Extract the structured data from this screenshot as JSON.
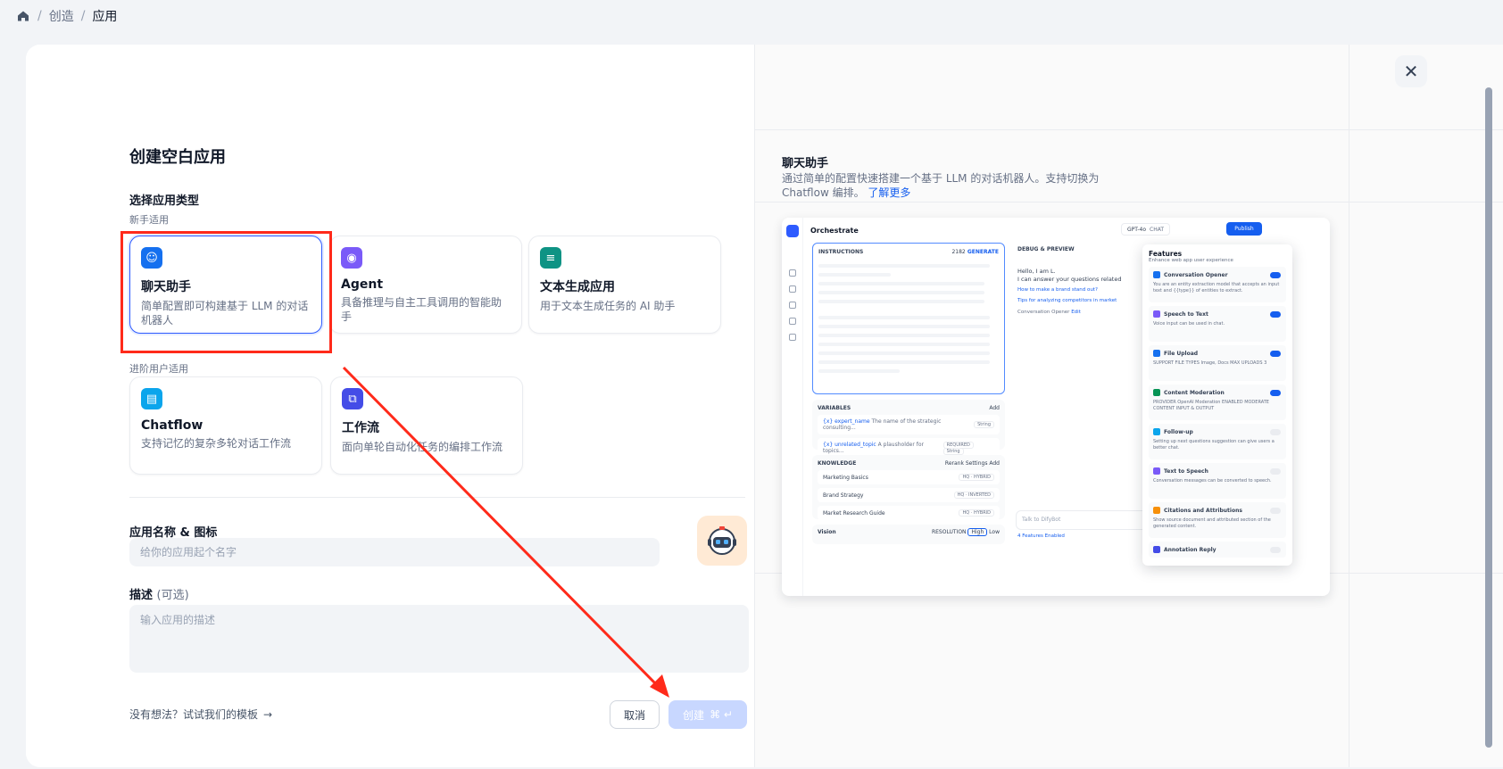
{
  "breadcrumb": {
    "items": [
      "创造",
      "应用"
    ],
    "sep": "/"
  },
  "modal": {
    "title": "创建空白应用",
    "type_section": "选择应用类型",
    "beginner_label": "新手适用",
    "advanced_label": "进阶用户适用",
    "types": [
      {
        "name": "聊天助手",
        "desc": "简单配置即可构建基于 LLM 的对话机器人",
        "color": "#1570ef",
        "selected": true
      },
      {
        "name": "Agent",
        "desc": "具备推理与自主工具调用的智能助手",
        "color": "#7a5af8"
      },
      {
        "name": "文本生成应用",
        "desc": "用于文本生成任务的 AI 助手",
        "color": "#0e9384"
      },
      {
        "name": "Chatflow",
        "desc": "支持记忆的复杂多轮对话工作流",
        "color": "#0ba5ec"
      },
      {
        "name": "工作流",
        "desc": "面向单轮自动化任务的编排工作流",
        "color": "#444ce7"
      }
    ],
    "name_label": "应用名称 & 图标",
    "name_placeholder": "给你的应用起个名字",
    "desc_label": "描述",
    "desc_optional": "(可选)",
    "desc_placeholder": "输入应用的描述",
    "template_link": "没有想法？试试我们的模板",
    "cancel": "取消",
    "create": "创建",
    "create_shortcut": "⌘ ↵"
  },
  "preview": {
    "title": "聊天助手",
    "desc": "通过简单的配置快速搭建一个基于 LLM 的对话机器人。支持切换为 Chatflow 编排。",
    "learn_more": "了解更多",
    "shot": {
      "orchestrate": "Orchestrate",
      "model": "GPT-4o",
      "model_tag": "CHAT",
      "publish": "Publish",
      "instructions": "INSTRUCTIONS",
      "instructions_count": "2182",
      "generate": "GENERATE",
      "variables": "VARIABLES",
      "add": "Add",
      "vars": [
        {
          "name": "{x} expert_name",
          "desc": "The name of the strategic consulting...",
          "type": "String"
        },
        {
          "name": "{x} unrelated_topic",
          "desc": "A plausholder for topics...",
          "type": "String",
          "req": "REQUIRED"
        }
      ],
      "knowledge": "KNOWLEDGE",
      "rerank": "Rerank Settings",
      "kbs": [
        {
          "name": "Marketing Basics",
          "tag": "HQ · HYBRID"
        },
        {
          "name": "Brand Strategy",
          "tag": "HQ · INVERTED"
        },
        {
          "name": "Market Research Guide",
          "tag": "HQ · HYBRID"
        }
      ],
      "vision": "Vision",
      "resolution": "RESOLUTION",
      "high": "High",
      "low": "Low",
      "debug": "DEBUG & PREVIEW",
      "hello": "Hello, I am L.",
      "can_answer": "I can answer your questions related",
      "q1": "How to make a brand stand out?",
      "q2": "Tips for analyzing competitors in market",
      "opener": "Conversation Opener",
      "edit": "Edit",
      "talk": "Talk to DifyBot",
      "features_enabled": "4 Features Enabled",
      "features_title": "Features",
      "features_sub": "Enhance web app user experience",
      "features": [
        {
          "name": "Conversation Opener",
          "desc": "You are an entity extraction model that accepts an input text and {{type}} of entities to extract.",
          "on": true,
          "color": "#1570ef"
        },
        {
          "name": "Speech to Text",
          "desc": "Voice input can be used in chat.",
          "on": true,
          "color": "#7a5af8"
        },
        {
          "name": "File Upload",
          "desc": "SUPPORT FILE TYPES Image, Docs    MAX UPLOADS 3",
          "on": true,
          "color": "#1570ef"
        },
        {
          "name": "Content Moderation",
          "desc": "PROVIDER OpenAI Moderation    ENABLED MODERATE CONTENT INPUT & OUTPUT",
          "on": true,
          "color": "#079455"
        },
        {
          "name": "Follow-up",
          "desc": "Setting up next questions suggestion can give users a better chat.",
          "on": false,
          "color": "#0ba5ec"
        },
        {
          "name": "Text to Speech",
          "desc": "Conversation messages can be converted to speech.",
          "on": false,
          "color": "#7a5af8"
        },
        {
          "name": "Citations and Attributions",
          "desc": "Show source document and attributed section of the generated content.",
          "on": false,
          "color": "#f79009"
        },
        {
          "name": "Annotation Reply",
          "desc": "",
          "on": false,
          "color": "#444ce7"
        }
      ]
    }
  }
}
